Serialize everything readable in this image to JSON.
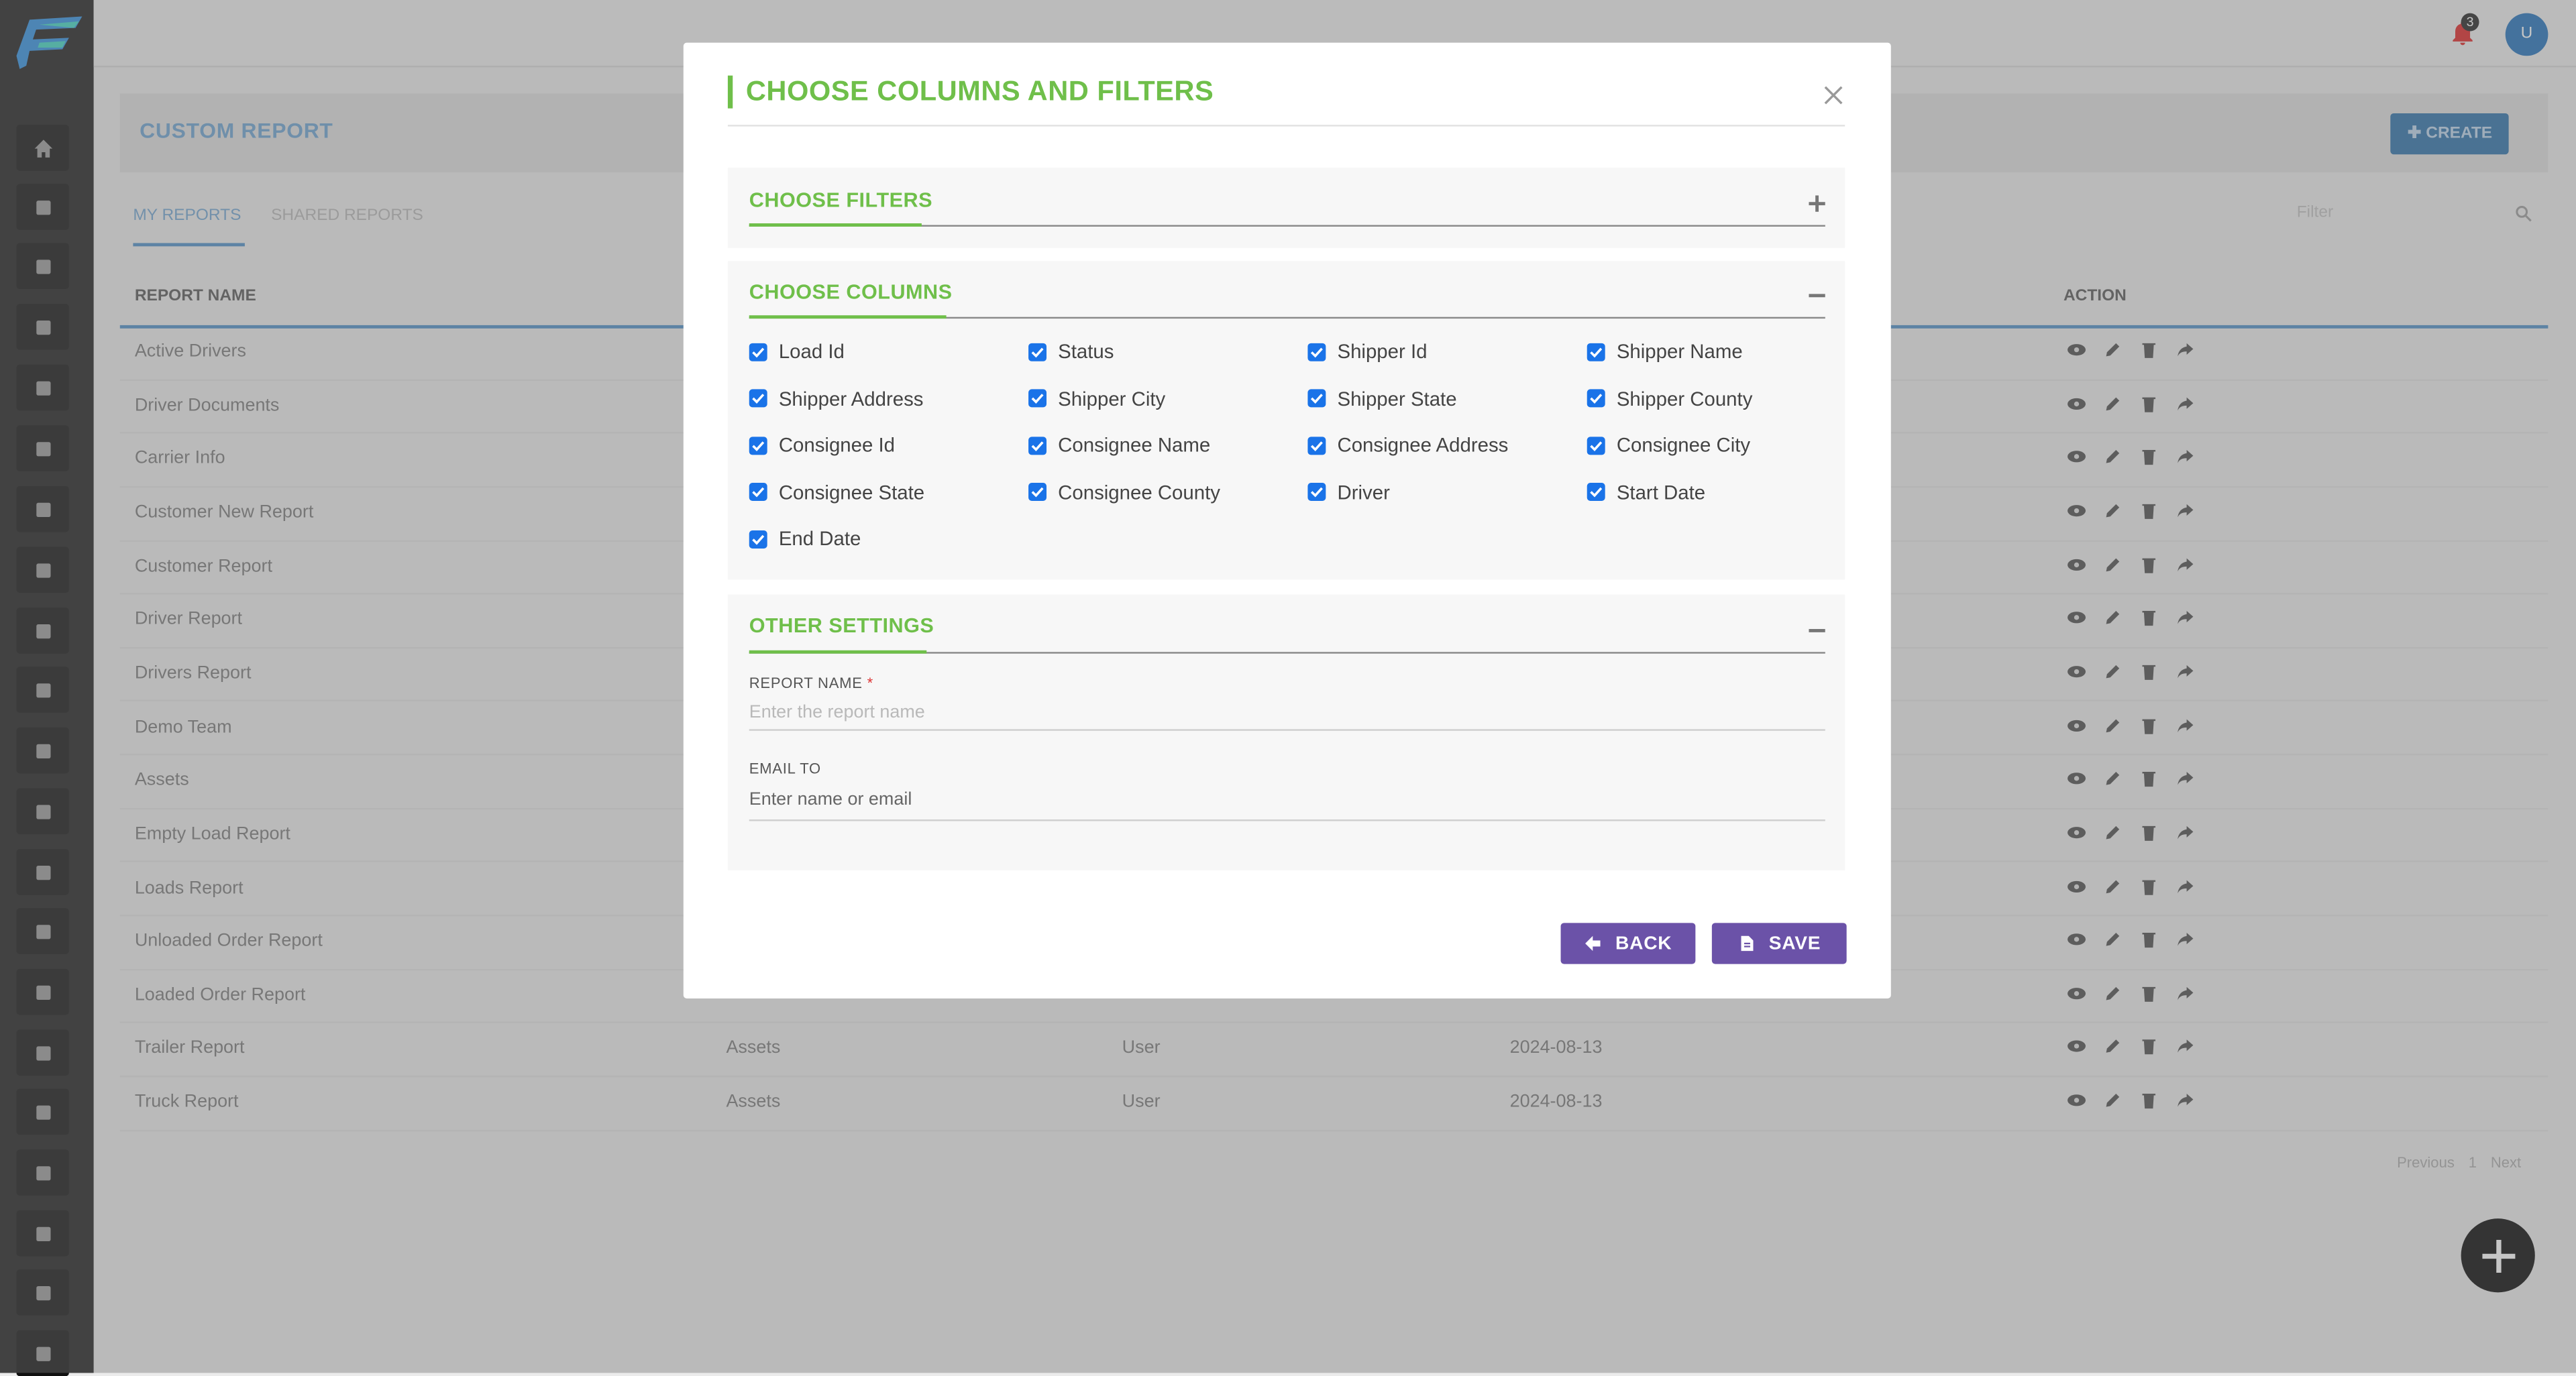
{
  "topbar": {
    "notification_count": "3",
    "avatar_initial": "U"
  },
  "page": {
    "title": "CUSTOM REPORT",
    "create_label": "CREATE",
    "tabs": [
      "MY REPORTS",
      "SHARED REPORTS"
    ],
    "filter_placeholder": "Filter",
    "columns": [
      "REPORT NAME",
      "ACTION"
    ],
    "rows": [
      {
        "name": "Active Drivers",
        "category": "",
        "shared": "",
        "date": ""
      },
      {
        "name": "Driver Documents",
        "category": "",
        "shared": "",
        "date": ""
      },
      {
        "name": "Carrier Info",
        "category": "",
        "shared": "",
        "date": ""
      },
      {
        "name": "Customer New Report",
        "category": "",
        "shared": "",
        "date": ""
      },
      {
        "name": "Customer Report",
        "category": "",
        "shared": "",
        "date": ""
      },
      {
        "name": "Driver Report",
        "category": "",
        "shared": "",
        "date": ""
      },
      {
        "name": "Drivers Report",
        "category": "",
        "shared": "",
        "date": ""
      },
      {
        "name": "Demo Team",
        "category": "",
        "shared": "",
        "date": ""
      },
      {
        "name": "Assets",
        "category": "",
        "shared": "",
        "date": ""
      },
      {
        "name": "Empty Load Report",
        "category": "",
        "shared": "",
        "date": ""
      },
      {
        "name": "Loads Report",
        "category": "",
        "shared": "",
        "date": ""
      },
      {
        "name": "Unloaded Order Report",
        "category": "",
        "shared": "",
        "date": ""
      },
      {
        "name": "Loaded Order Report",
        "category": "",
        "shared": "",
        "date": ""
      },
      {
        "name": "Trailer Report",
        "category": "Assets",
        "shared": "User",
        "date": "2024-08-13"
      },
      {
        "name": "Truck Report",
        "category": "Assets",
        "shared": "User",
        "date": "2024-08-13"
      }
    ],
    "pagination": {
      "previous": "Previous",
      "page": "1",
      "next": "Next"
    }
  },
  "modal": {
    "title": "CHOOSE COLUMNS AND FILTERS",
    "filters_section": {
      "title": "CHOOSE FILTERS"
    },
    "columns_section": {
      "title": "CHOOSE COLUMNS",
      "items": [
        "Load Id",
        "Status",
        "Shipper Id",
        "Shipper Name",
        "Shipper Address",
        "Shipper City",
        "Shipper State",
        "Shipper County",
        "Consignee Id",
        "Consignee Name",
        "Consignee Address",
        "Consignee City",
        "Consignee State",
        "Consignee County",
        "Driver",
        "Start Date",
        "End Date"
      ],
      "checked": true
    },
    "settings_section": {
      "title": "OTHER SETTINGS",
      "report_name_label": "REPORT NAME",
      "required_mark": "*",
      "report_name_placeholder": "Enter the report name",
      "email_label": "EMAIL TO",
      "email_placeholder": "Enter name or email"
    },
    "back_label": "BACK",
    "save_label": "SAVE"
  },
  "colors": {
    "accent_green": "#6fbf4a",
    "button_purple": "#6b52a8",
    "checkbox_blue": "#1a73e8",
    "brand_blue": "#2a6ea8"
  },
  "icons": [
    "home-icon",
    "bell-icon",
    "eye-icon",
    "pencil-icon",
    "trash-icon",
    "share-icon",
    "plus-icon",
    "minus-icon",
    "close-icon",
    "arrow-left-icon",
    "file-icon",
    "search-icon"
  ]
}
